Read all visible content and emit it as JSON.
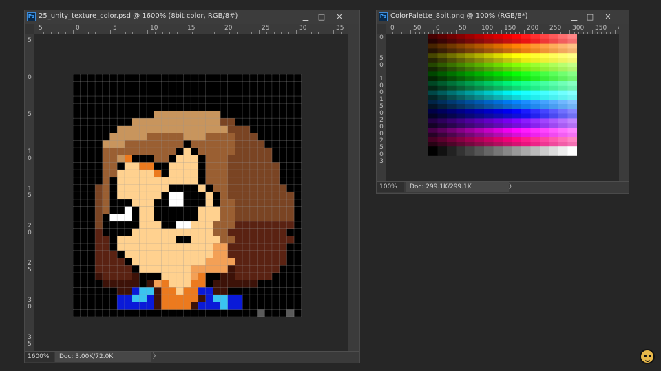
{
  "left_window": {
    "title": "25_unity_texture_color.psd @ 1600% (8bit color, RGB/8#)",
    "ruler_top": [
      "5",
      "0",
      "5",
      "10",
      "15",
      "20",
      "25",
      "30",
      "35"
    ],
    "ruler_left": [
      [
        "5"
      ],
      [
        "0"
      ],
      [
        "5"
      ],
      [
        "1",
        "0"
      ],
      [
        "1",
        "5"
      ],
      [
        "2",
        "0"
      ],
      [
        "2",
        "5"
      ],
      [
        "3",
        "0"
      ],
      [
        "3",
        "5"
      ]
    ],
    "status_zoom": "1600%",
    "status_doc": "Doc: 3.00K/72.0K",
    "status_arrow": "〉",
    "palette": {
      "K": "#000000",
      "B": "#9a5f32",
      "b": "#c8955d",
      "d": "#7a4423",
      "r": "#5a2212",
      "m": "#3d1208",
      "s": "#ffd18f",
      "o": "#f3a056",
      "O": "#ec7a1e",
      "w": "#ffffff",
      "U": "#0a1ad8",
      "c": "#3ac3f0",
      "g": "#5a5a5a"
    },
    "pixels": [
      "..............................",
      "..............................",
      "..............................",
      "..............................",
      "..............................",
      "...........bbbbbbbbb..........",
      "........bbbbbbbbbbbbdd........",
      "......bbbbbbbbbbbbbbbddd......",
      ".....bbbbbBBBBBbbbBBBBddd.....",
      "....bbbBBBBBBBBKBBBBBBdddd....",
      "....BBBBBBBBBBKsKBBBBBddddd...",
      "....BBbOKKKBBKsssKBBBdddddd...",
      "....BBKssOOKKssssKBBBddddddd..",
      "....BBsssssOKssssKBBBddddddd..",
      "....BKsssssssssssKBBBddddddd..",
      "...dBKsssssssKKKKsKBBdddddddd.",
      "...dBKssssssKwwKKKsKBddddddddd",
      "...dBKKKsssKKwwKKKsKBBdddddddd",
      "...dBKKwKssKKKKKKsssBBdddddddd",
      "...dKwwwKssKKKKKKsssBBdddddddd",
      "...dKKKKKsssKKwwsssBBBrrrrrrrr",
      "...rKKKKsssssssssssBBrrrrrrrr.",
      "...rrKssssssssKKssssBBrrrrrrrr.",
      "...rrKsssssssssssssoorrrrrrrr..",
      "...rrrKssssssssssssoorrrrrrrr..",
      "...rrrrKssssssssssoooorrrrrrr..",
      "...rrrrrKsssssssooooomrrrrrr...",
      "...mrrrrmKKKssssoOKKmmrrrrr....",
      "....mmmmmKmoOsssOOKmmmmmm......",
      "......mmUccmOOsOOUUmm..........",
      "......UUccUmOOOOOmUccUU........",
      "......UUUUUmOOOOmUUUcUU........",
      ".........................g...g"
    ]
  },
  "right_window": {
    "title": "ColorPalette_8bit.png @ 100% (RGB/8*)",
    "ruler_top": [
      "0",
      "50",
      "0",
      "50",
      "100",
      "150",
      "200",
      "250",
      "300",
      "350",
      "4"
    ],
    "ruler_left": [
      [
        "0"
      ],
      [
        "5",
        "0"
      ],
      [
        "1",
        "0",
        "0"
      ],
      [
        "1",
        "5",
        "0"
      ],
      [
        "2",
        "0",
        "0"
      ],
      [
        "2",
        "5",
        "0"
      ],
      [
        "3"
      ]
    ],
    "status_zoom": "100%",
    "status_doc": "Doc: 299.1K/299.1K",
    "status_arrow": "〉",
    "hue_rows": [
      {
        "hue": 0
      },
      {
        "hue": 30
      },
      {
        "hue": 60
      },
      {
        "hue": 90
      },
      {
        "hue": 120
      },
      {
        "hue": 150
      },
      {
        "hue": 180
      },
      {
        "hue": 210
      },
      {
        "hue": 240
      },
      {
        "hue": 270
      },
      {
        "hue": 300
      },
      {
        "hue": 330
      }
    ]
  },
  "icons": {
    "minimize": "▁",
    "maximize": "□",
    "close": "✕"
  }
}
